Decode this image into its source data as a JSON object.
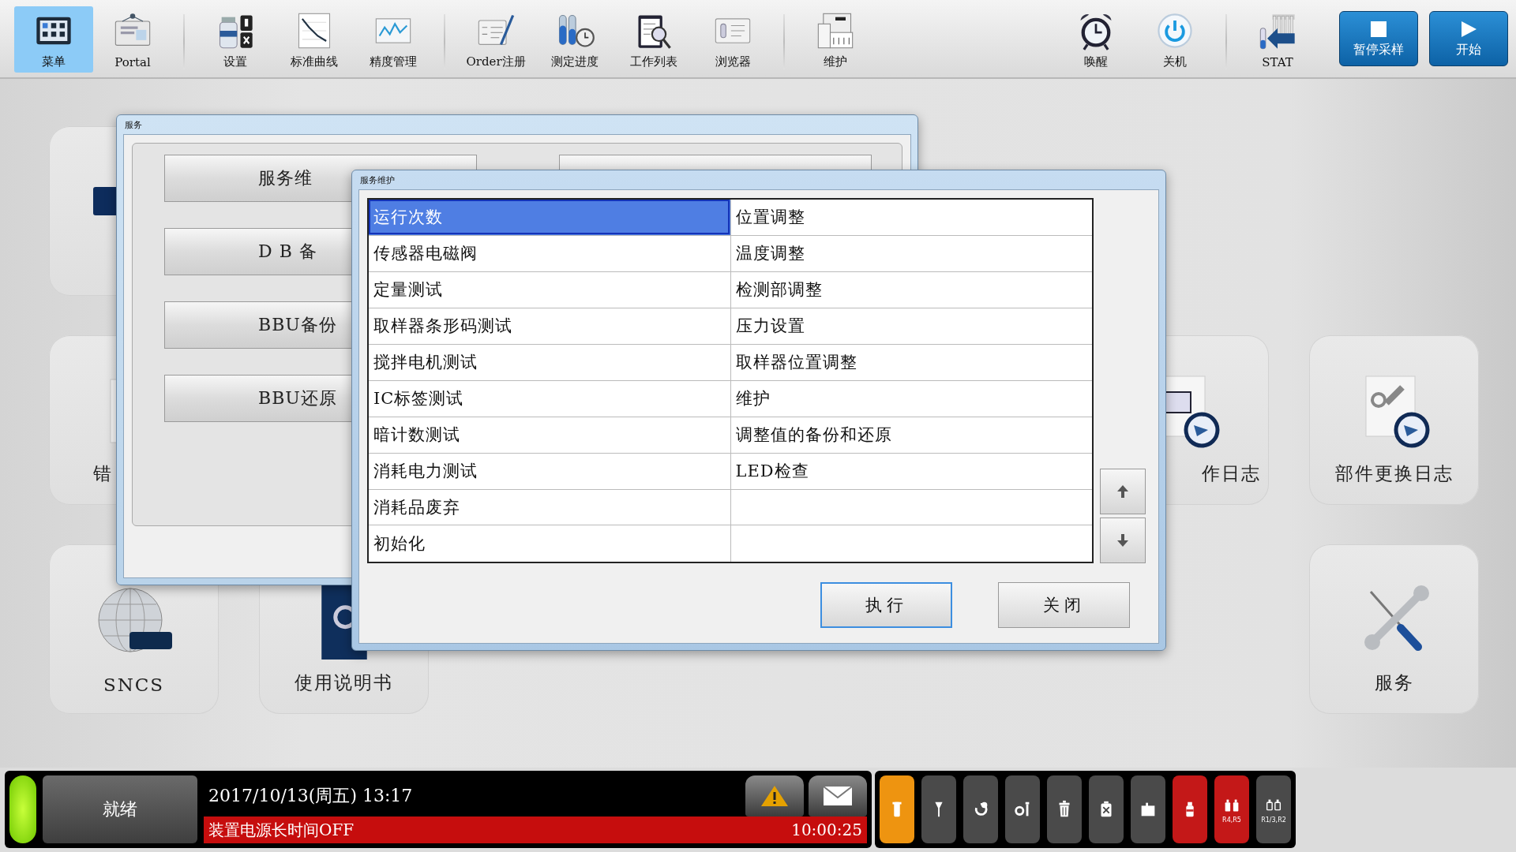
{
  "toolbar": {
    "left_groups": [
      [
        {
          "label": "菜单",
          "selected": true
        },
        {
          "label": "Portal",
          "selected": false
        }
      ],
      [
        {
          "label": "设置",
          "selected": false
        },
        {
          "label": "标准曲线",
          "selected": false
        },
        {
          "label": "精度管理",
          "selected": false
        }
      ],
      [
        {
          "label": "Order注册",
          "selected": false
        },
        {
          "label": "测定进度",
          "selected": false
        },
        {
          "label": "工作列表",
          "selected": false
        },
        {
          "label": "浏览器",
          "selected": false
        }
      ],
      [
        {
          "label": "维护",
          "selected": false
        }
      ]
    ],
    "right_groups": [
      [
        {
          "label": "唤醒",
          "selected": false
        },
        {
          "label": "关机",
          "selected": false
        }
      ],
      [
        {
          "label": "STAT",
          "selected": false
        }
      ]
    ],
    "action_buttons": [
      {
        "label": "暂停采样",
        "kind": "stop"
      },
      {
        "label": "开始",
        "kind": "play"
      }
    ]
  },
  "tiles": [
    {
      "kind": "blank"
    },
    {
      "kind": "tile",
      "label": "错"
    },
    {
      "kind": "tile",
      "label": "SNCS"
    },
    {
      "kind": "tile",
      "label": "使用说明书"
    },
    {
      "kind": "tile",
      "label": "作日志"
    },
    {
      "kind": "tile",
      "label": "部件更换日志"
    },
    {
      "kind": "tile",
      "label": "服务"
    }
  ],
  "service_dialog": {
    "title": "服务",
    "buttons": [
      {
        "label": "服务维"
      },
      {
        "label": "D B 备"
      },
      {
        "label": "BBU备份"
      },
      {
        "label": "BBU还原"
      }
    ]
  },
  "maintenance_dialog": {
    "title": "服务维护",
    "rows": [
      {
        "cells": [
          {
            "text": "运行次数",
            "selected": true
          },
          {
            "text": "位置调整",
            "selected": false
          }
        ]
      },
      {
        "cells": [
          {
            "text": "传感器电磁阀",
            "selected": false
          },
          {
            "text": "温度调整",
            "selected": false
          }
        ]
      },
      {
        "cells": [
          {
            "text": "定量测试",
            "selected": false
          },
          {
            "text": "检测部调整",
            "selected": false
          }
        ]
      },
      {
        "cells": [
          {
            "text": "取样器条形码测试",
            "selected": false
          },
          {
            "text": "压力设置",
            "selected": false
          }
        ]
      },
      {
        "cells": [
          {
            "text": "搅拌电机测试",
            "selected": false
          },
          {
            "text": "取样器位置调整",
            "selected": false
          }
        ]
      },
      {
        "cells": [
          {
            "text": "IC标签测试",
            "selected": false
          },
          {
            "text": "维护",
            "selected": false
          }
        ]
      },
      {
        "cells": [
          {
            "text": "暗计数测试",
            "selected": false
          },
          {
            "text": "调整值的备份和还原",
            "selected": false
          }
        ]
      },
      {
        "cells": [
          {
            "text": "消耗电力测试",
            "selected": false
          },
          {
            "text": "LED检查",
            "selected": false
          }
        ]
      },
      {
        "cells": [
          {
            "text": "消耗品废弃",
            "selected": false
          },
          {
            "selected": false
          }
        ]
      },
      {
        "cells": [
          {
            "text": "初始化",
            "selected": false
          },
          {
            "selected": false
          }
        ]
      }
    ],
    "buttons": [
      {
        "label": "执行",
        "focused": true
      },
      {
        "label": "关闭",
        "focused": false
      }
    ]
  },
  "status_bar": {
    "state": "就绪",
    "datetime": "2017/10/13(周五) 13:17",
    "alarm": {
      "message": "装置电源长时间OFF",
      "time": "10:00:25"
    },
    "icon_buttons": [
      {
        "color": "#ee9410"
      },
      {
        "color": "#4a4a4a"
      },
      {
        "color": "#4a4a4a"
      },
      {
        "color": "#4a4a4a"
      },
      {
        "color": "#4a4a4a"
      },
      {
        "color": "#4a4a4a"
      },
      {
        "color": "#4a4a4a"
      },
      {
        "color": "#c41818"
      },
      {
        "color": "#c41818",
        "caption": "R4,R5"
      },
      {
        "color": "#4a4a4a",
        "caption": "R1/3,R2"
      }
    ]
  }
}
